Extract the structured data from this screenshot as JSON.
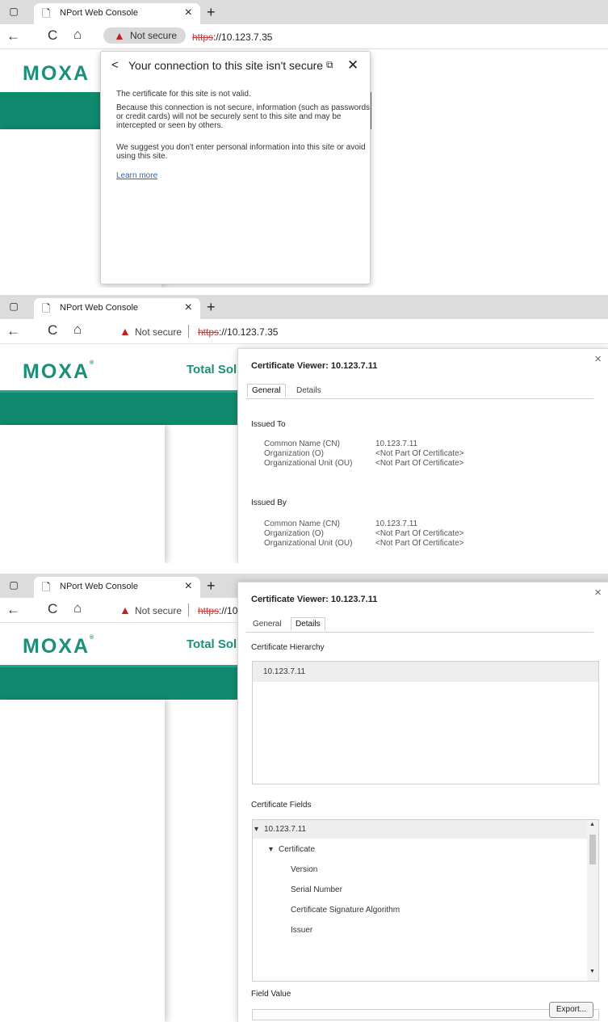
{
  "browser": {
    "tab_title": "NPort Web Console",
    "close_tab_symbol": "×",
    "new_tab_symbol": "+",
    "tab_actions_symbol": "▢",
    "page_icon_symbol": "🗋",
    "back_symbol": "←",
    "refresh_symbol": "C",
    "home_symbol": "⌂",
    "security_warning_symbol": "▲",
    "security_label": "Not secure",
    "url_scheme": "https",
    "url_rest": "://10.123.7.35"
  },
  "site": {
    "logo": "MOXA",
    "registered": "®",
    "total_heading": "Total Solu"
  },
  "security_popup": {
    "back_symbol": "<",
    "title": "Your connection to this site isn't secure",
    "certificate_symbol": "⧉",
    "close_symbol": "✕",
    "paragraph_1": "The certificate for this site is not valid.",
    "paragraph_2": "Because this connection is not secure, information (such as passwords or credit cards) will not be securely sent to this site and may be intercepted or seen by others.",
    "paragraph_3": "We suggest you don't enter personal information into this site or avoid using this site.",
    "learn_more": "Learn more"
  },
  "certificate_general": {
    "title": "Certificate Viewer: 10.123.7.11",
    "close_symbol": "×",
    "tabs": [
      "General",
      "Details"
    ],
    "issued_to": "Issued To",
    "issued_by": "Issued By",
    "labels": [
      "Common Name (CN)",
      "Organization (O)",
      "Organizational Unit (OU)"
    ],
    "issued_to_values": [
      "10.123.7.11",
      "<Not Part Of Certificate>",
      "<Not Part Of Certificate>"
    ],
    "issued_by_values": [
      "10.123.7.11",
      "<Not Part Of Certificate>",
      "<Not Part Of Certificate>"
    ]
  },
  "certificate_details": {
    "title": "Certificate Viewer: 10.123.7.11",
    "close_symbol": "×",
    "tabs": [
      "General",
      "Details"
    ],
    "hierarchy_label": "Certificate Hierarchy",
    "hierarchy_item": "10.123.7.11",
    "fields_label": "Certificate Fields",
    "expanded_symbol": "▾",
    "fields": [
      "10.123.7.11",
      "Certificate",
      "Version",
      "Serial Number",
      "Certificate Signature Algorithm",
      "Issuer"
    ],
    "scroll_up_symbol": "▲",
    "scroll_down_symbol": "▼",
    "field_value_label": "Field Value",
    "export_button": "Export..."
  },
  "colors": {
    "brand_green": "#1c8f78",
    "banner_green": "#0f8a6f",
    "warning_red": "#c41f1f"
  }
}
